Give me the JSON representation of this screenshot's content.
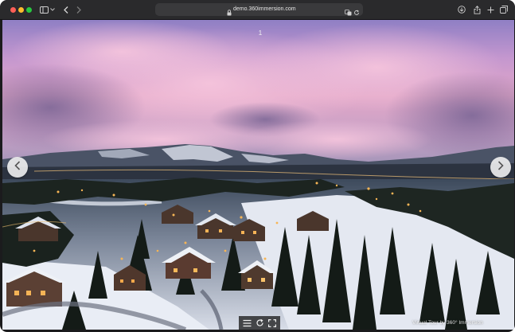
{
  "browser": {
    "address": {
      "url": "demo.360immersion.com"
    },
    "icons": {
      "sidebar": "sidebar-icon",
      "back": "chevron-left-icon",
      "forward": "chevron-right-icon",
      "lock": "lock-icon",
      "reader": "translate-icon",
      "reload": "reload-icon",
      "download": "download-icon",
      "share": "share-icon",
      "new_tab": "plus-icon",
      "tabs": "tab-overview-icon"
    }
  },
  "viewer": {
    "page_number": "1",
    "credit": "Virtual Tour by 360° Immersion",
    "controls": [
      "menu-icon",
      "rotate-icon",
      "fullscreen-icon"
    ]
  },
  "colors": {
    "toolbar": "#2a2a2c",
    "address_bar": "#3a3a3c",
    "close": "#ff5f57",
    "minimize": "#febc2e",
    "maximize": "#28c840",
    "sky_top": "#9a86c9",
    "sky_pink": "#e8a6c8",
    "snow": "#e9eef6",
    "forest": "#1f2622",
    "lights": "#f2a84a"
  }
}
